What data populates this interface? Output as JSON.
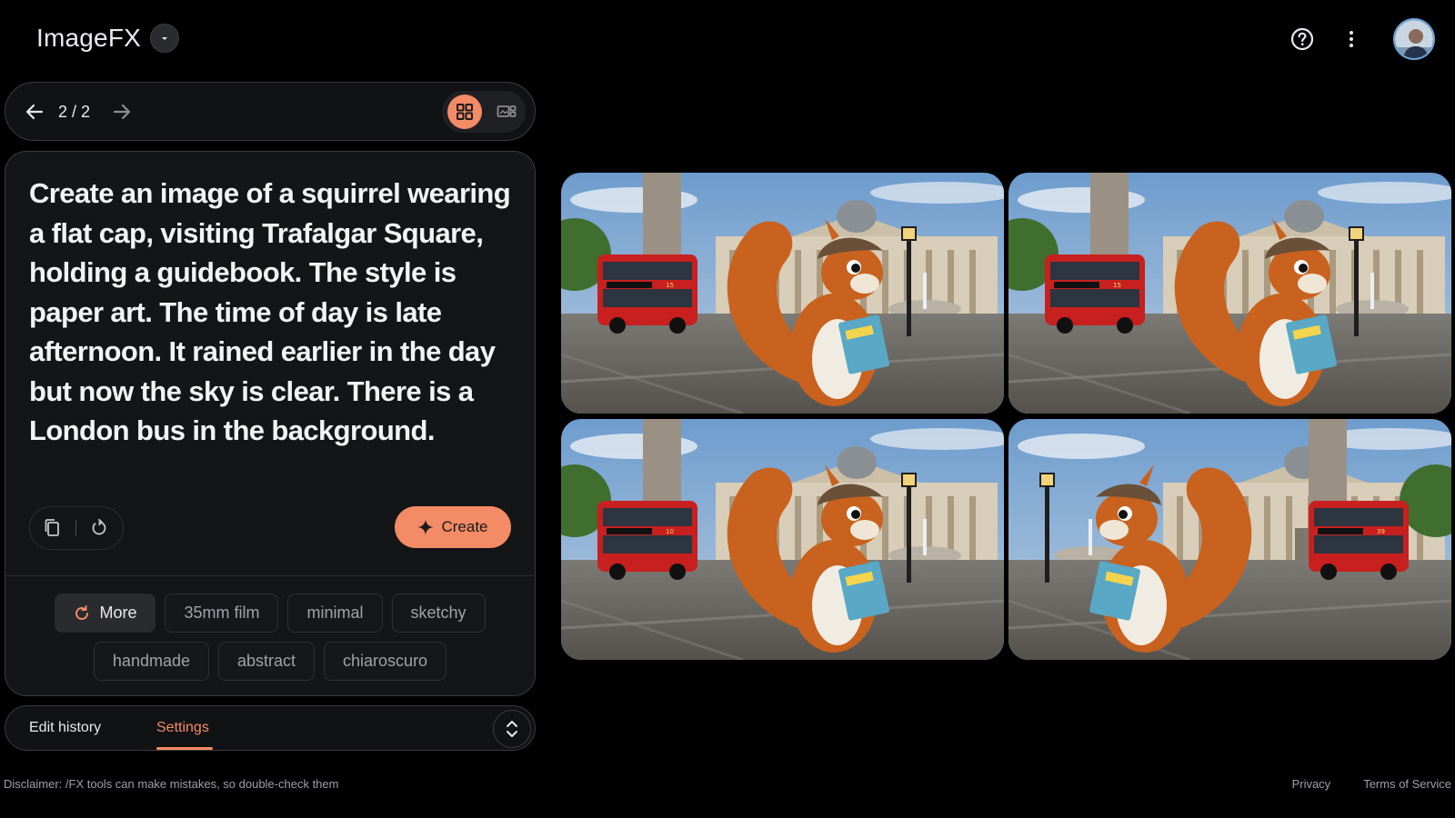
{
  "app": {
    "title": "ImageFX"
  },
  "navigation": {
    "counter": "2 / 2"
  },
  "prompt": {
    "text": "Create an image of a squirrel wearing a flat cap, visiting Trafalgar Square, holding a guidebook. The style is paper art. The time of day is late afternoon. It rained earlier in the day but now the sky is clear. There is a London bus in the background."
  },
  "actions": {
    "create_label": "Create"
  },
  "suggestions": {
    "more_label": "More",
    "row1": [
      "35mm film",
      "minimal",
      "sketchy"
    ],
    "row2": [
      "handmade",
      "abstract",
      "chiaroscuro"
    ]
  },
  "tabs": {
    "edit_history": "Edit history",
    "settings": "Settings",
    "active": "settings"
  },
  "footer": {
    "disclaimer": "Disclaimer: /FX tools can make mistakes, so double-check them",
    "privacy": "Privacy",
    "terms": "Terms of Service"
  },
  "images": [
    {
      "bus_text": "15",
      "bus_side": "left",
      "squirrel_side": "right"
    },
    {
      "bus_text": "15",
      "bus_side": "left",
      "squirrel_side": "right"
    },
    {
      "bus_text": "10",
      "bus_side": "left",
      "squirrel_side": "right"
    },
    {
      "bus_text": "39",
      "bus_side": "right",
      "squirrel_side": "left"
    }
  ],
  "colors": {
    "accent": "#f28b66",
    "background": "#000000",
    "panel": "#141517",
    "bus_red": "#c8201f",
    "squirrel_orange": "#c8621e"
  }
}
